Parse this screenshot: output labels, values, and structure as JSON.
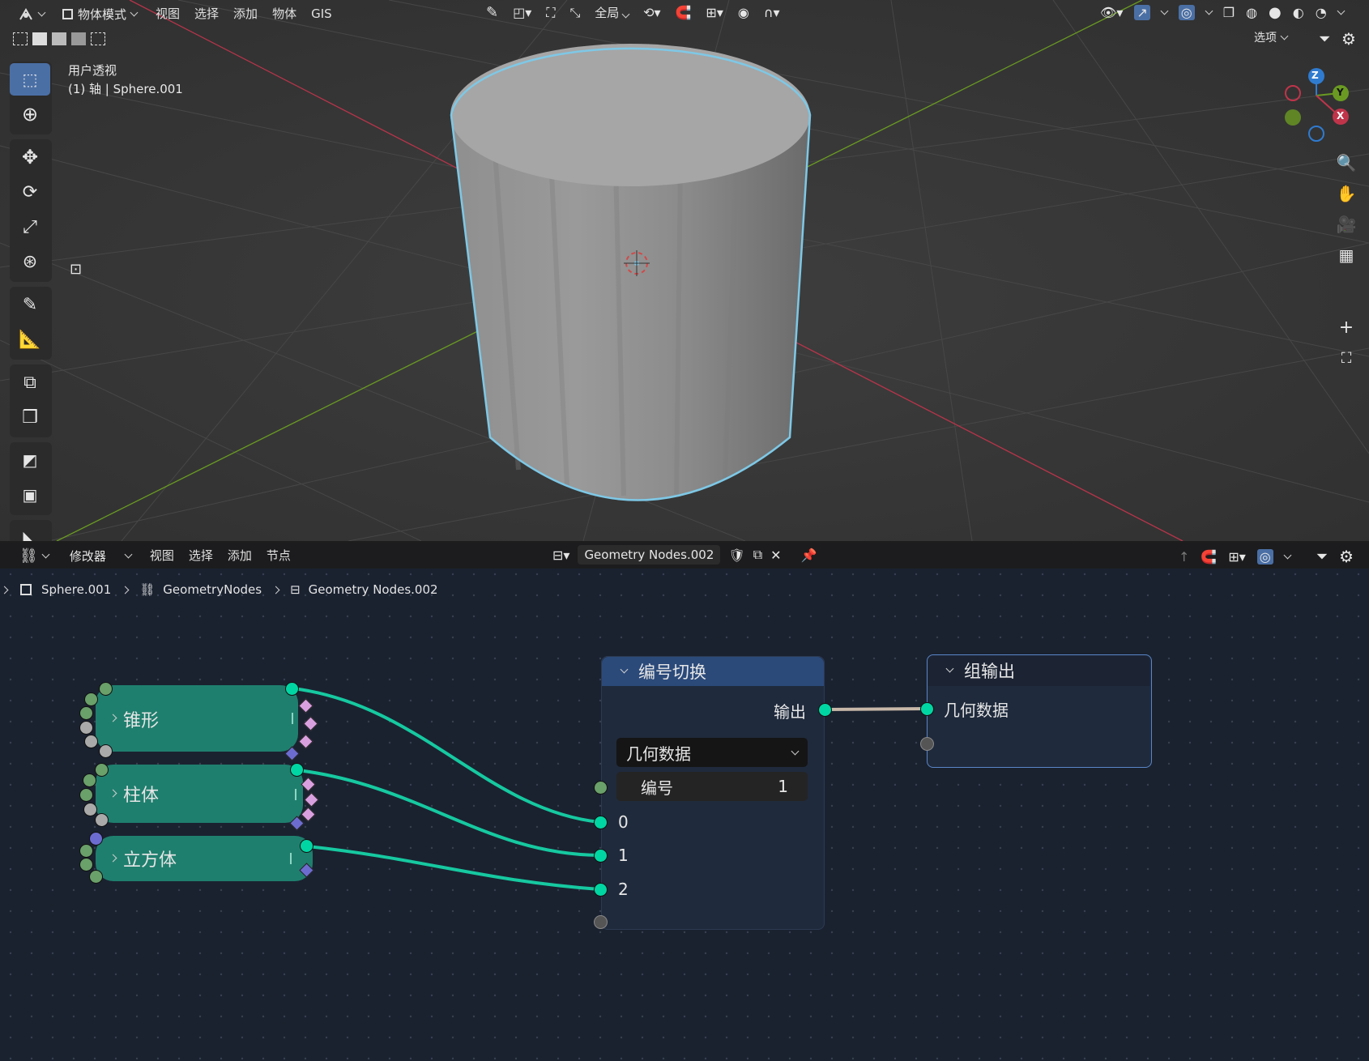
{
  "viewport": {
    "top_menu": {
      "mode_label": "物体模式",
      "items": [
        "视图",
        "选择",
        "添加",
        "物体",
        "GIS"
      ],
      "transform_orientation": "全局",
      "options_label": "选项"
    },
    "info": {
      "view_name": "用户透视",
      "object_info": "(1) 轴 | Sphere.001"
    },
    "gizmo": {
      "z": "Z",
      "y": "Y",
      "x": "X"
    },
    "colors": {
      "x_axis": "#c0344a",
      "y_axis": "#6a9a22",
      "z_axis": "#2f7bd0",
      "selection_outline": "#7ec8e6"
    }
  },
  "node_editor": {
    "header": {
      "editor_type_label": "修改器",
      "items": [
        "视图",
        "选择",
        "添加",
        "节点"
      ],
      "node_tree_name": "Geometry Nodes.002"
    },
    "breadcrumb": [
      "Sphere.001",
      "GeometryNodes",
      "Geometry Nodes.002"
    ],
    "frame_nodes": [
      {
        "label": "锥形"
      },
      {
        "label": "柱体"
      },
      {
        "label": "立方体"
      }
    ],
    "index_switch": {
      "title": "编号切换",
      "output_label": "输出",
      "type_value": "几何数据",
      "index_label": "编号",
      "index_value": "1",
      "inputs": [
        "0",
        "1",
        "2"
      ]
    },
    "group_output": {
      "title": "组输出",
      "input_label": "几何数据"
    },
    "colors": {
      "geometry_socket": "#00d6a3",
      "link": "#16c9a0",
      "header_blue": "#2b4a7a",
      "frame_teal": "#1f7f6e"
    }
  }
}
